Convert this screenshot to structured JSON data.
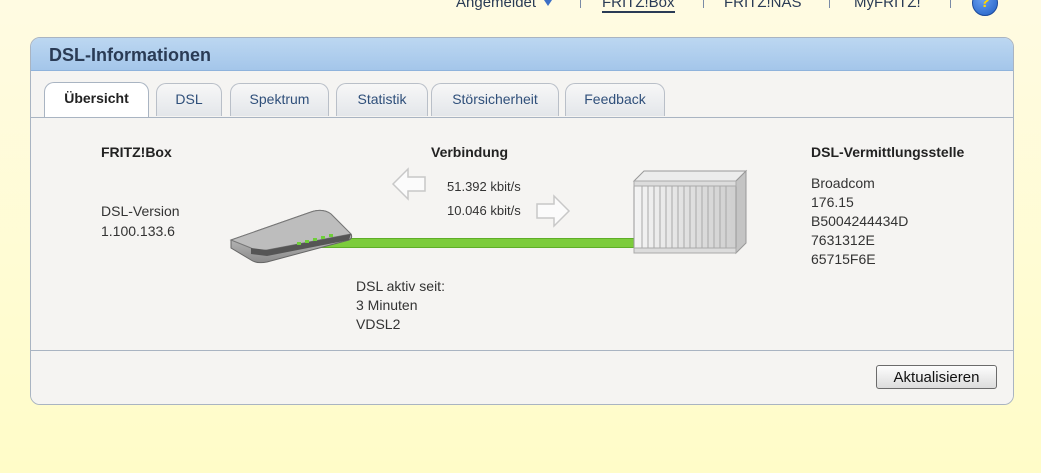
{
  "topnav": {
    "logged_in": "Angemeldet",
    "fritzbox": "FRITZ!Box",
    "fritznas": "FRITZ!NAS",
    "myfritz": "MyFRITZ!",
    "help": "?"
  },
  "panel": {
    "title": "DSL-Informationen",
    "tabs": [
      "Übersicht",
      "DSL",
      "Spektrum",
      "Statistik",
      "Störsicherheit",
      "Feedback"
    ],
    "active_tab": "Übersicht"
  },
  "fritzbox": {
    "heading": "FRITZ!Box",
    "version_label": "DSL-Version",
    "version": "1.100.133.6"
  },
  "connection": {
    "heading": "Verbindung",
    "downstream": "51.392 kbit/s",
    "upstream": "10.046 kbit/s",
    "active_label": "DSL aktiv seit:",
    "active_duration": "3 Minuten",
    "mode": "VDSL2",
    "line_color": "#7ccc3c"
  },
  "exchange": {
    "heading": "DSL-Vermittlungsstelle",
    "values": [
      "Broadcom",
      "176.15",
      "B5004244434D",
      "7631312E",
      "65715F6E"
    ]
  },
  "footer": {
    "refresh_label": "Aktualisieren"
  }
}
